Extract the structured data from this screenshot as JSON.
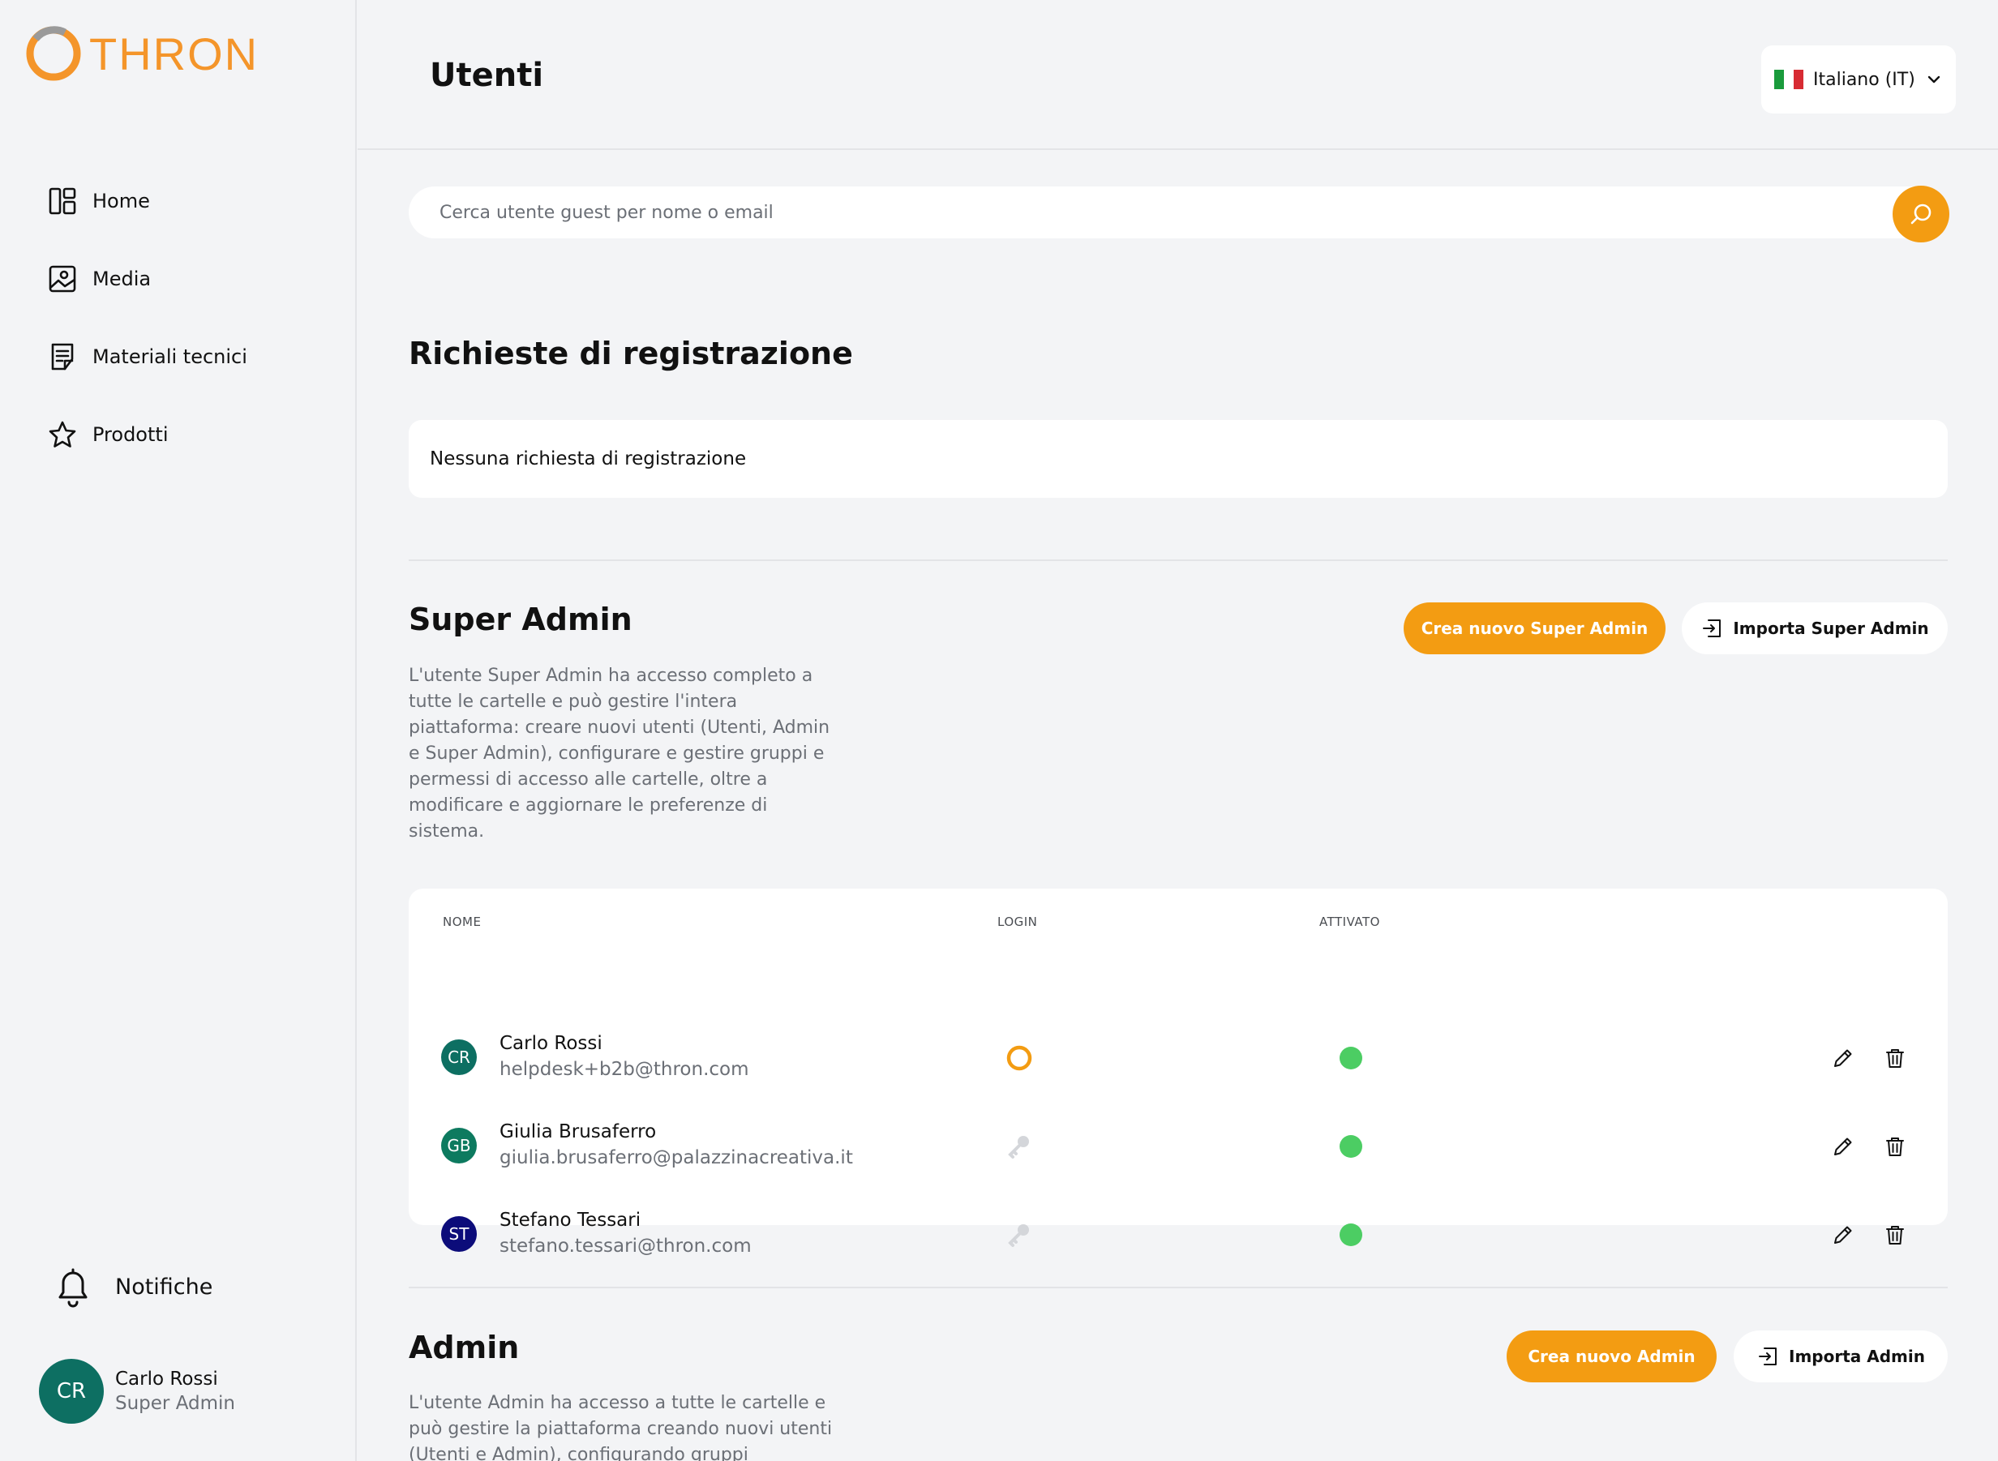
{
  "brand": {
    "name": "THRON",
    "accent": "#f39c12"
  },
  "sidebar": {
    "items": [
      {
        "label": "Home",
        "icon": "dashboard-icon"
      },
      {
        "label": "Media",
        "icon": "image-icon"
      },
      {
        "label": "Materiali tecnici",
        "icon": "document-icon"
      },
      {
        "label": "Prodotti",
        "icon": "star-icon"
      }
    ],
    "notifications_label": "Notifiche",
    "user": {
      "initials": "CR",
      "name": "Carlo Rossi",
      "role": "Super Admin"
    }
  },
  "header": {
    "title": "Utenti",
    "language": "Italiano (IT)"
  },
  "search": {
    "placeholder": "Cerca utente guest per nome o email"
  },
  "registration": {
    "title": "Richieste di registrazione",
    "empty_text": "Nessuna richiesta di registrazione"
  },
  "super_admin": {
    "title": "Super Admin",
    "description": "L'utente Super Admin ha accesso completo a tutte le cartelle e può gestire l'intera piattaforma: creare nuovi utenti (Utenti, Admin e Super Admin), configurare e gestire gruppi e permessi di accesso alle cartelle, oltre a modificare e aggiornare le preferenze di sistema.",
    "create_label": "Crea nuovo Super Admin",
    "import_label": "Importa Super Admin",
    "columns": {
      "name": "NOME",
      "login": "LOGIN",
      "activated": "ATTIVATO"
    },
    "rows": [
      {
        "initials": "CR",
        "name": "Carlo Rossi",
        "email": "helpdesk+b2b@thron.com",
        "login": "ring-icon",
        "activated": true,
        "avatar_color": "#0d6f62"
      },
      {
        "initials": "GB",
        "name": "Giulia Brusaferro",
        "email": "giulia.brusaferro@palazzinacreativa.it",
        "login": "key-icon",
        "activated": true,
        "avatar_color": "#0d7a5f"
      },
      {
        "initials": "ST",
        "name": "Stefano Tessari",
        "email": "stefano.tessari@thron.com",
        "login": "key-icon",
        "activated": true,
        "avatar_color": "#0c0c7a"
      }
    ]
  },
  "admin": {
    "title": "Admin",
    "description": "L'utente Admin ha accesso a tutte le cartelle e può gestire la piattaforma creando nuovi utenti (Utenti e Admin), configurando gruppi",
    "create_label": "Crea nuovo Admin",
    "import_label": "Importa Admin"
  }
}
